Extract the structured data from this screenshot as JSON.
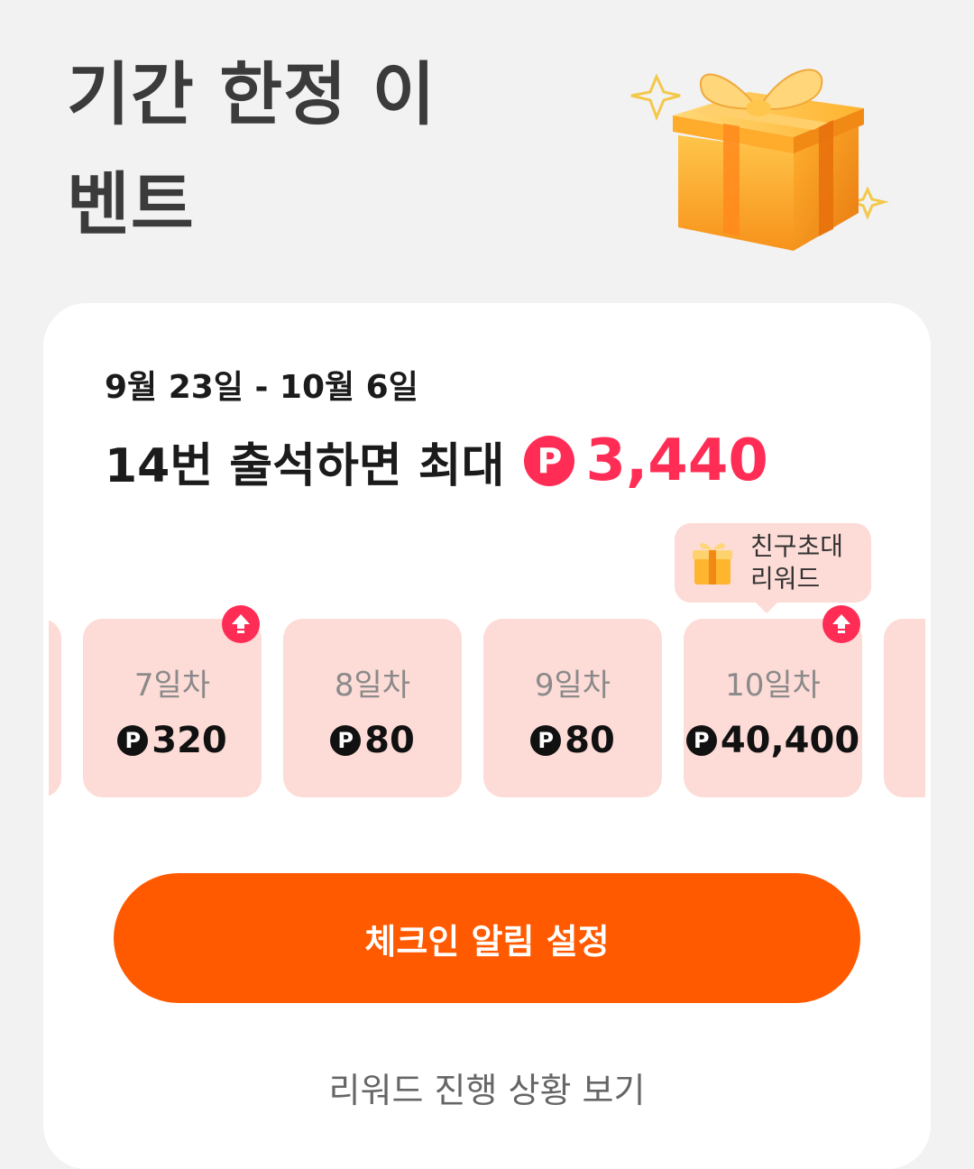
{
  "header": {
    "title_line1": "기간 한정 이",
    "title_line2": "벤트",
    "hero_icon": "gift-box-icon"
  },
  "event": {
    "date_range": "9월 23일 - 10월 6일",
    "headline_text": "14번 출석하면 최대",
    "coin_symbol": "P",
    "max_reward": "3,440",
    "accent_color": "#ff2d55"
  },
  "days": [
    {
      "label": "7일차",
      "amount": "320",
      "boosted": true
    },
    {
      "label": "8일차",
      "amount": "80",
      "boosted": false
    },
    {
      "label": "9일차",
      "amount": "80",
      "boosted": false
    },
    {
      "label": "10일차",
      "amount": "40,400",
      "boosted": true
    }
  ],
  "tooltip": {
    "line1": "친구초대",
    "line2": "리워드",
    "icon": "gift-box-icon"
  },
  "actions": {
    "checkin_alarm": "체크인 알림 설정",
    "view_progress": "리워드 진행 상황 보기",
    "button_color": "#ff5a00"
  },
  "colors": {
    "background": "#f2f2f2",
    "card": "#ffffff",
    "day_box": "#fddbd6"
  }
}
